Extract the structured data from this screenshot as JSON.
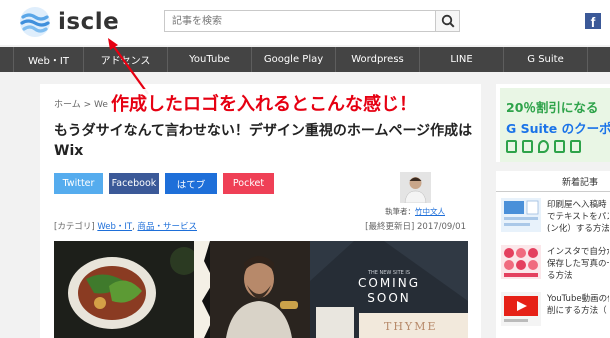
{
  "header": {
    "logo_text": "iscle",
    "search_placeholder": "記事を検索",
    "social_icon": "facebook-icon"
  },
  "nav": {
    "items": [
      "Web・IT",
      "アドセンス",
      "YouTube",
      "Google Play",
      "Wordpress",
      "LINE",
      "G Suite"
    ]
  },
  "annotation": {
    "text": "作成したロゴを入れるとこんな感じ！",
    "color": "#e60012"
  },
  "article": {
    "breadcrumb": "ホーム > We",
    "title": "もうダサイなんて言わせない！デザイン重視のホームページ作成はWix",
    "share_buttons": [
      {
        "label": "Twitter",
        "color": "#55acee"
      },
      {
        "label": "Facebook",
        "color": "#3b5998"
      },
      {
        "label": "はてブ",
        "color": "#1e6fd9"
      },
      {
        "label": "Pocket",
        "color": "#ef4056"
      }
    ],
    "author_prefix": "執筆者：",
    "author_name": "竹中文人",
    "category_label": "[カテゴリ]",
    "category_1": "Web・IT",
    "category_2": "商品・サービス",
    "updated_label": "[最終更新日]",
    "updated_date": "2017/09/01",
    "hero": {
      "coming_soon_line1": "COMING",
      "coming_soon_line2": "SOON",
      "thyme": "THYME",
      "small_caption": "THE NEW SITE IS"
    }
  },
  "sidebar": {
    "ad": {
      "line1": "20％割引になる",
      "line2": "G Suite のクーポ"
    },
    "recent_heading": "新着記事",
    "items": [
      {
        "text": "印刷屋へ入稿時\nでテキストをパス\n(ン化）する方法"
      },
      {
        "text": "インスタで自分が\n保存した写真の一\nる方法"
      },
      {
        "text": "YouTube動画の付\n削にする方法（"
      }
    ]
  }
}
